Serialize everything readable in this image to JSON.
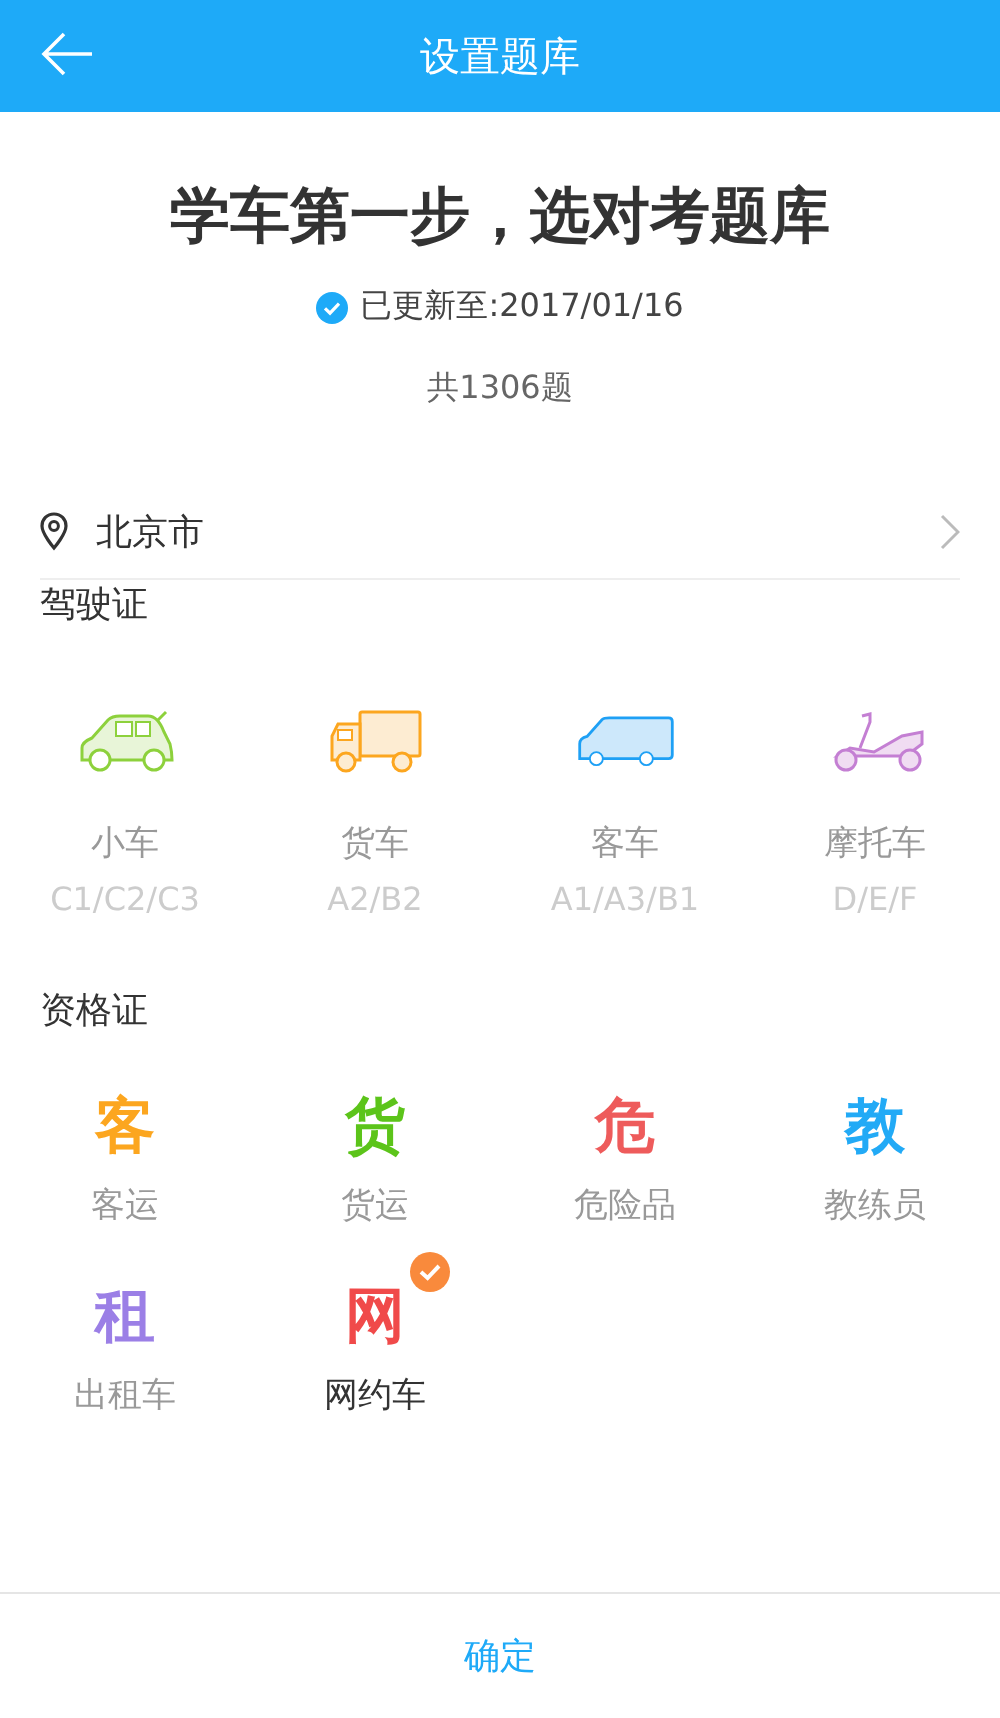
{
  "header": {
    "title": "设置题库"
  },
  "headline": "学车第一步，选对考题库",
  "update": {
    "text": "已更新至:2017/01/16",
    "verified": true
  },
  "count": "共1306题",
  "location": {
    "city": "北京市"
  },
  "license": {
    "heading": "驾驶证",
    "items": [
      {
        "kind": "car",
        "name": "小车",
        "classes": "C1/C2/C3",
        "selected": false
      },
      {
        "kind": "truck",
        "name": "货车",
        "classes": "A2/B2",
        "selected": false
      },
      {
        "kind": "van",
        "name": "客车",
        "classes": "A1/A3/B1",
        "selected": false
      },
      {
        "kind": "scooter",
        "name": "摩托车",
        "classes": "D/E/F",
        "selected": false
      }
    ]
  },
  "qualification": {
    "heading": "资格证",
    "items": [
      {
        "glyph": "客",
        "color": "#fca61f",
        "name": "客运",
        "selected": false
      },
      {
        "glyph": "货",
        "color": "#5cc41a",
        "name": "货运",
        "selected": false
      },
      {
        "glyph": "危",
        "color": "#ee5b5b",
        "name": "危险品",
        "selected": false
      },
      {
        "glyph": "教",
        "color": "#22aaf6",
        "name": "教练员",
        "selected": false
      },
      {
        "glyph": "租",
        "color": "#9b7fe6",
        "name": "出租车",
        "selected": false
      },
      {
        "glyph": "网",
        "color": "#f04a4a",
        "name": "网约车",
        "selected": true
      }
    ]
  },
  "confirm": "确定"
}
